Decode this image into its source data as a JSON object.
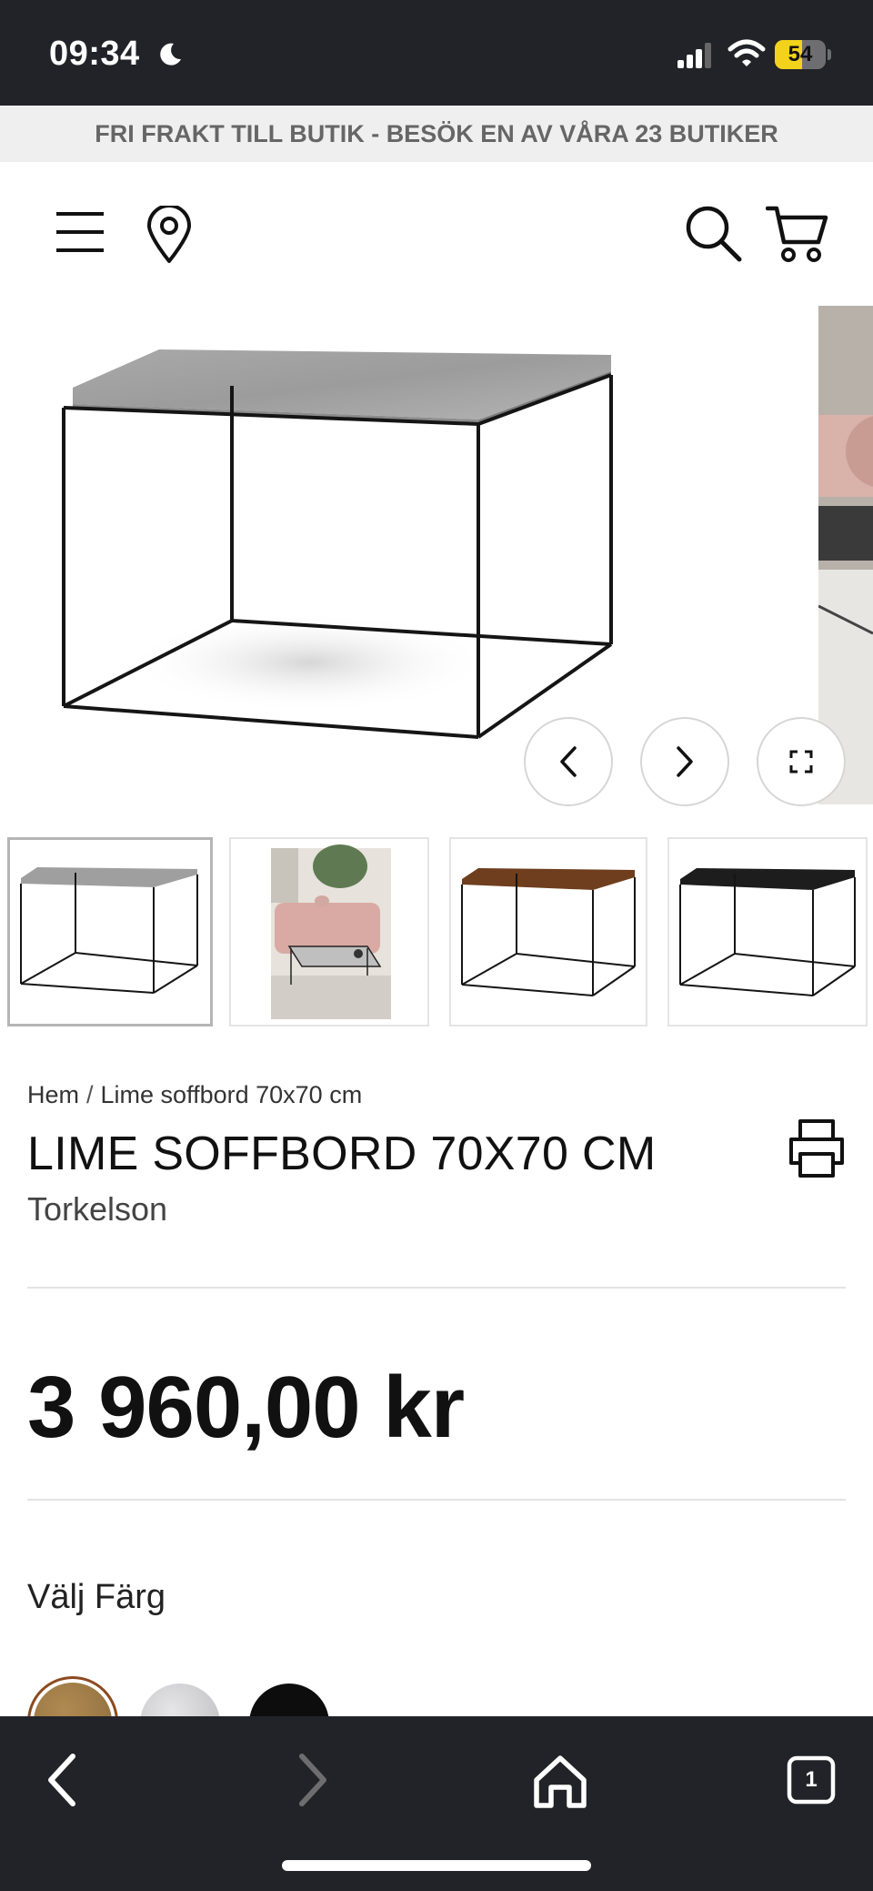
{
  "status_bar": {
    "time": "09:34",
    "battery_level": "54",
    "battery_fraction": 0.54,
    "icons": [
      "moon-icon",
      "signal-icon",
      "wifi-icon",
      "battery-icon"
    ]
  },
  "promo_banner": {
    "text": "FRI FRAKT TILL BUTIK - BESÖK EN AV VÅRA 23 BUTIKER"
  },
  "header": {
    "icons": [
      "menu-icon",
      "location-pin-icon",
      "search-icon",
      "cart-icon"
    ]
  },
  "gallery": {
    "icons": [
      "chevron-left-icon",
      "chevron-right-icon",
      "fullscreen-icon"
    ],
    "thumbnails": [
      {
        "variant": "grey-top",
        "selected": true
      },
      {
        "variant": "lifestyle-room",
        "selected": false
      },
      {
        "variant": "brown-top",
        "selected": false
      },
      {
        "variant": "black-top",
        "selected": false
      }
    ]
  },
  "breadcrumb": {
    "home": "Hem",
    "separator": "/",
    "current": "Lime soffbord 70x70 cm"
  },
  "product": {
    "title": "LIME SOFFBORD 70X70 CM",
    "brand": "Torkelson",
    "price": "3 960,00 kr",
    "color_label": "Välj Färg",
    "swatches": [
      {
        "name": "brown",
        "color": "#8a6a3a"
      },
      {
        "name": "silver",
        "color": "#b9b9bb"
      },
      {
        "name": "black",
        "color": "#0d0d0d"
      }
    ]
  },
  "toolbar": {
    "tabs_count": "1",
    "icons": [
      "back-arrow-icon",
      "forward-arrow-icon",
      "home-icon",
      "tabs-icon"
    ]
  },
  "colors": {
    "dark_chrome": "#222328",
    "banner_bg": "#efefef",
    "banner_text": "#666666",
    "battery_yellow": "#f2d21b"
  }
}
